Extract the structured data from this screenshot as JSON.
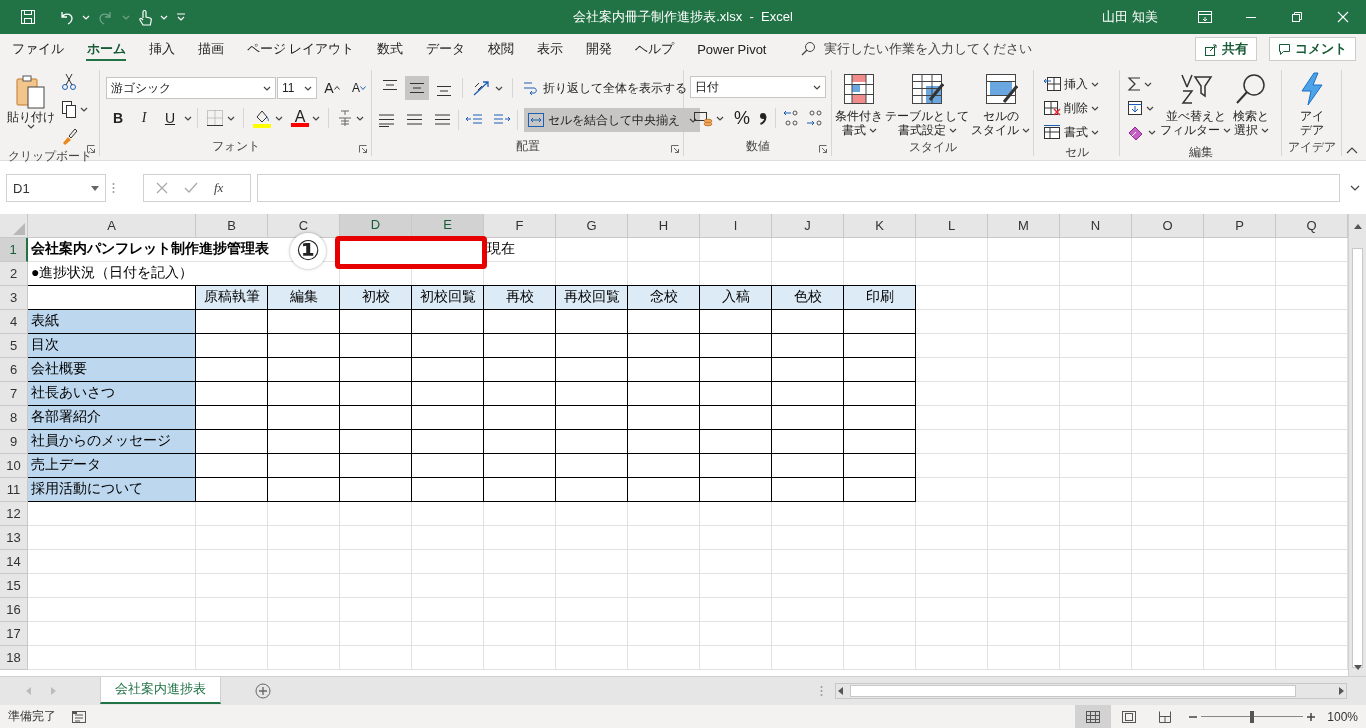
{
  "title_bar": {
    "title": "会社案内冊子制作進捗表.xlsx  -  Excel",
    "user": "山田 知美"
  },
  "menu_tabs": [
    {
      "label": "ファイル",
      "selected": false
    },
    {
      "label": "ホーム",
      "selected": true
    },
    {
      "label": "挿入",
      "selected": false
    },
    {
      "label": "描画",
      "selected": false
    },
    {
      "label": "ページ レイアウト",
      "selected": false
    },
    {
      "label": "数式",
      "selected": false
    },
    {
      "label": "データ",
      "selected": false
    },
    {
      "label": "校閲",
      "selected": false
    },
    {
      "label": "表示",
      "selected": false
    },
    {
      "label": "開発",
      "selected": false
    },
    {
      "label": "ヘルプ",
      "selected": false
    },
    {
      "label": "Power Pivot",
      "selected": false
    }
  ],
  "tell_me": {
    "placeholder": "実行したい作業を入力してください"
  },
  "share_button": "共有",
  "comment_button": "コメント",
  "ribbon": {
    "clipboard": {
      "label": "クリップボード",
      "paste": "貼り付け"
    },
    "font": {
      "label": "フォント",
      "font_name": "游ゴシック",
      "font_size": "11",
      "grow": "A",
      "shrink": "A",
      "bold": "B",
      "italic": "I",
      "underline": "U",
      "font_color": "A"
    },
    "alignment": {
      "label": "配置",
      "vertical_align": [
        {
          "kind": "top",
          "selected": false
        },
        {
          "kind": "middle",
          "selected": true
        },
        {
          "kind": "bottom",
          "selected": false
        }
      ],
      "wrap_text": "折り返して全体を表示する",
      "merge_center": {
        "label": "セルを結合して中央揃え",
        "selected": true
      }
    },
    "number": {
      "label": "数値",
      "format": "日付",
      "percent": "%"
    },
    "styles": {
      "label": "スタイル",
      "buttons": [
        [
          "条件付き",
          "書式"
        ],
        [
          "テーブルとして",
          "書式設定"
        ],
        [
          "セルの",
          "スタイル"
        ]
      ]
    },
    "cells": {
      "label": "セル",
      "buttons": [
        "挿入",
        "削除",
        "書式"
      ]
    },
    "editing": {
      "label": "編集",
      "buttons": [
        [
          "並べ替えと",
          "フィルター"
        ],
        [
          "検索と",
          "選択"
        ]
      ]
    },
    "ideas": {
      "label": "アイデア",
      "button": [
        "アイ",
        "デア"
      ]
    }
  },
  "formula_bar": {
    "name_box": "D1",
    "function_label": "fx"
  },
  "sheet": {
    "columns": [
      {
        "label": "A",
        "selected": false
      },
      {
        "label": "B",
        "selected": false
      },
      {
        "label": "C",
        "selected": false
      },
      {
        "label": "D",
        "selected": true
      },
      {
        "label": "E",
        "selected": true
      },
      {
        "label": "F",
        "selected": false
      },
      {
        "label": "G",
        "selected": false
      },
      {
        "label": "H",
        "selected": false
      },
      {
        "label": "I",
        "selected": false
      },
      {
        "label": "J",
        "selected": false
      },
      {
        "label": "K",
        "selected": false
      },
      {
        "label": "L",
        "selected": false
      },
      {
        "label": "M",
        "selected": false
      },
      {
        "label": "N",
        "selected": false
      },
      {
        "label": "O",
        "selected": false
      },
      {
        "label": "P",
        "selected": false
      },
      {
        "label": "Q",
        "selected": false
      }
    ],
    "row_headers": [
      {
        "label": "1",
        "selected": true
      },
      {
        "label": "2",
        "selected": false
      },
      {
        "label": "3",
        "selected": false
      },
      {
        "label": "4",
        "selected": false
      },
      {
        "label": "5",
        "selected": false
      },
      {
        "label": "6",
        "selected": false
      },
      {
        "label": "7",
        "selected": false
      },
      {
        "label": "8",
        "selected": false
      },
      {
        "label": "9",
        "selected": false
      },
      {
        "label": "10",
        "selected": false
      },
      {
        "label": "11",
        "selected": false
      },
      {
        "label": "12",
        "selected": false
      },
      {
        "label": "13",
        "selected": false
      },
      {
        "label": "14",
        "selected": false
      },
      {
        "label": "15",
        "selected": false
      },
      {
        "label": "16",
        "selected": false
      },
      {
        "label": "17",
        "selected": false
      },
      {
        "label": "18",
        "selected": false
      }
    ],
    "title": "会社案内パンフレット制作進捗管理表",
    "date_suffix": "現在",
    "subtitle": "●進捗状況（日付を記入）",
    "stage_headers": [
      "原稿執筆",
      "編集",
      "初校",
      "初校回覧",
      "再校",
      "再校回覧",
      "念校",
      "入稿",
      "色校",
      "印刷"
    ],
    "sections": [
      "表紙",
      "目次",
      "会社概要",
      "社長あいさつ",
      "各部署紹介",
      "社員からのメッセージ",
      "売上データ",
      "採用活動について"
    ],
    "annotation": {
      "marker": "①",
      "highlight": true
    }
  },
  "sheet_tabs": [
    {
      "label": "会社案内進捗表",
      "selected": true
    }
  ],
  "status_bar": {
    "status": "準備完了",
    "view_modes": [
      {
        "kind": "normal",
        "selected": true
      },
      {
        "kind": "page_layout",
        "selected": false
      },
      {
        "kind": "page_break",
        "selected": false
      }
    ],
    "zoom_slider": {
      "level": 0.5
    },
    "zoom": "100%"
  }
}
